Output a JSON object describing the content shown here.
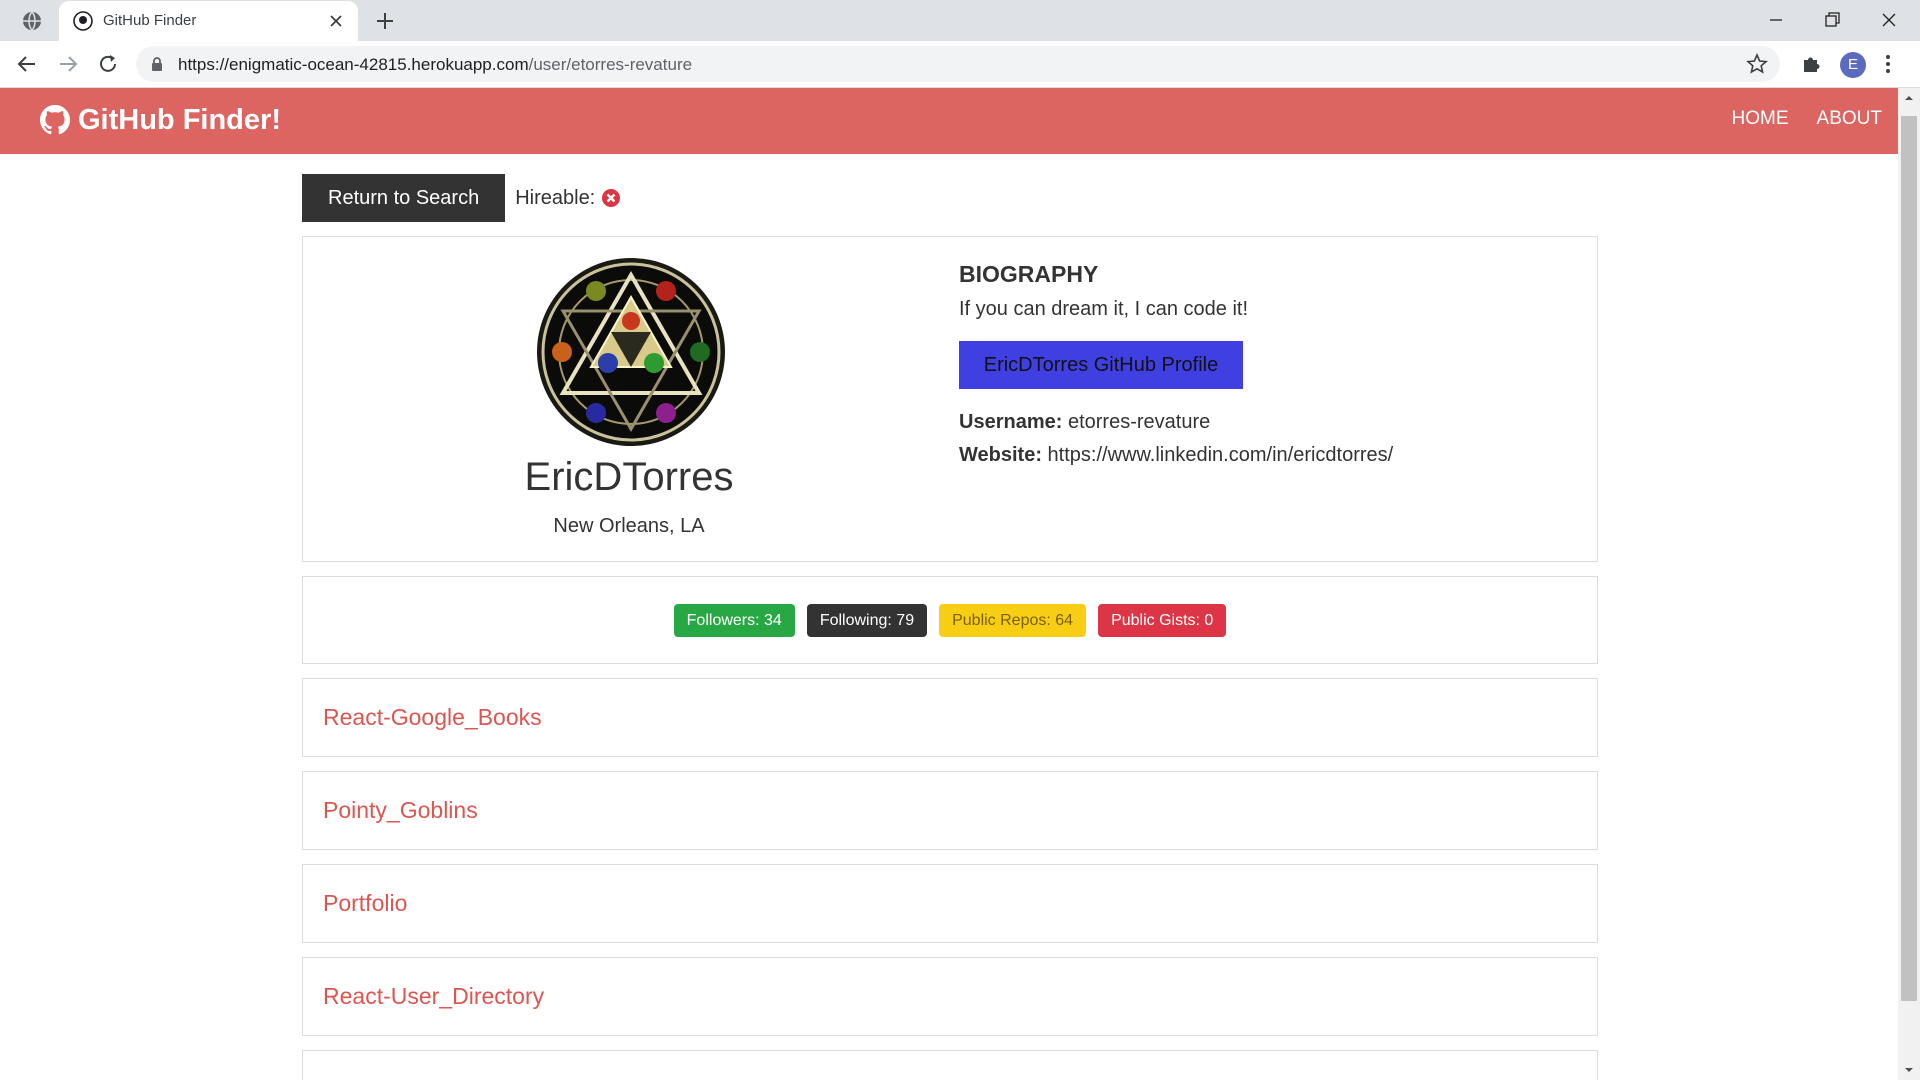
{
  "browser": {
    "tab_title": "GitHub Finder",
    "url_host": "https://enigmatic-ocean-42815.herokuapp.com",
    "url_path": "/user/etorres-revature",
    "profile_initial": "E"
  },
  "app": {
    "brand": "GitHub Finder!",
    "nav": {
      "home": "HOME",
      "about": "ABOUT"
    },
    "colors": {
      "navbar": "#dc6461",
      "repo_link": "#dc5651",
      "profile_button": "#4040e2"
    }
  },
  "topline": {
    "back_button": "Return to Search",
    "hireable_label": "Hireable:"
  },
  "profile": {
    "name": "EricDTorres",
    "location": "New Orleans, LA",
    "bio_heading": "BIOGRAPHY",
    "bio": "If you can dream it, I can code it!",
    "profile_button": "EricDTorres GitHub Profile",
    "username_label": "Username:",
    "username": "etorres-revature",
    "website_label": "Website:",
    "website": "https://www.linkedin.com/in/ericdtorres/"
  },
  "badges": {
    "followers": "Followers: 34",
    "following": "Following: 79",
    "repos": "Public Repos: 64",
    "gists": "Public Gists: 0"
  },
  "repos": [
    {
      "name": "React-Google_Books"
    },
    {
      "name": "Pointy_Goblins"
    },
    {
      "name": "Portfolio"
    },
    {
      "name": "React-User_Directory"
    }
  ]
}
